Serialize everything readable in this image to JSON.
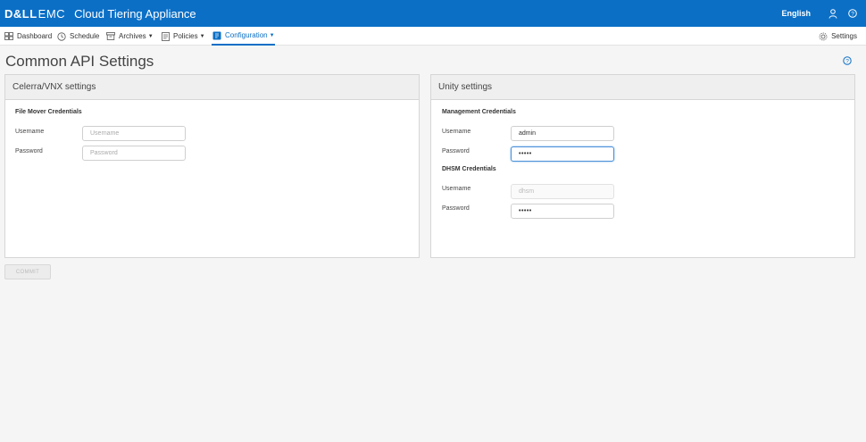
{
  "header": {
    "brand_dell": "D&LL",
    "brand_emc": "EMC",
    "app_title": "Cloud Tiering Appliance",
    "language": "English",
    "user_icon": "user-icon",
    "help_icon": "help-circle-icon",
    "accent": "#0b6fc6"
  },
  "nav": {
    "items": [
      {
        "label": "Dashboard",
        "icon": "dashboard-icon"
      },
      {
        "label": "Schedule",
        "icon": "clock-icon"
      },
      {
        "label": "Archives",
        "icon": "archive-icon"
      },
      {
        "label": "Policies",
        "icon": "policy-icon"
      },
      {
        "label": "Configuration",
        "icon": "configuration-icon",
        "active": true
      }
    ],
    "settings_label": "Settings",
    "settings_icon": "gear-icon"
  },
  "page": {
    "title": "Common API Settings"
  },
  "celerra": {
    "title": "Celerra/VNX settings",
    "section": "File Mover Credentials",
    "username_label": "Username",
    "username_placeholder": "Username",
    "password_label": "Password",
    "password_placeholder": "Password"
  },
  "unity": {
    "title": "Unity settings",
    "mgmt_section": "Management Credentials",
    "mgmt_username_label": "Username",
    "mgmt_username_value": "admin",
    "mgmt_password_label": "Password",
    "mgmt_password_value": "•••••",
    "dhsm_section": "DHSM Credentials",
    "dhsm_username_label": "Username",
    "dhsm_username_value": "dhsm",
    "dhsm_password_label": "Password",
    "dhsm_password_value": "•••••"
  },
  "actions": {
    "commit_label": "COMMIT"
  }
}
